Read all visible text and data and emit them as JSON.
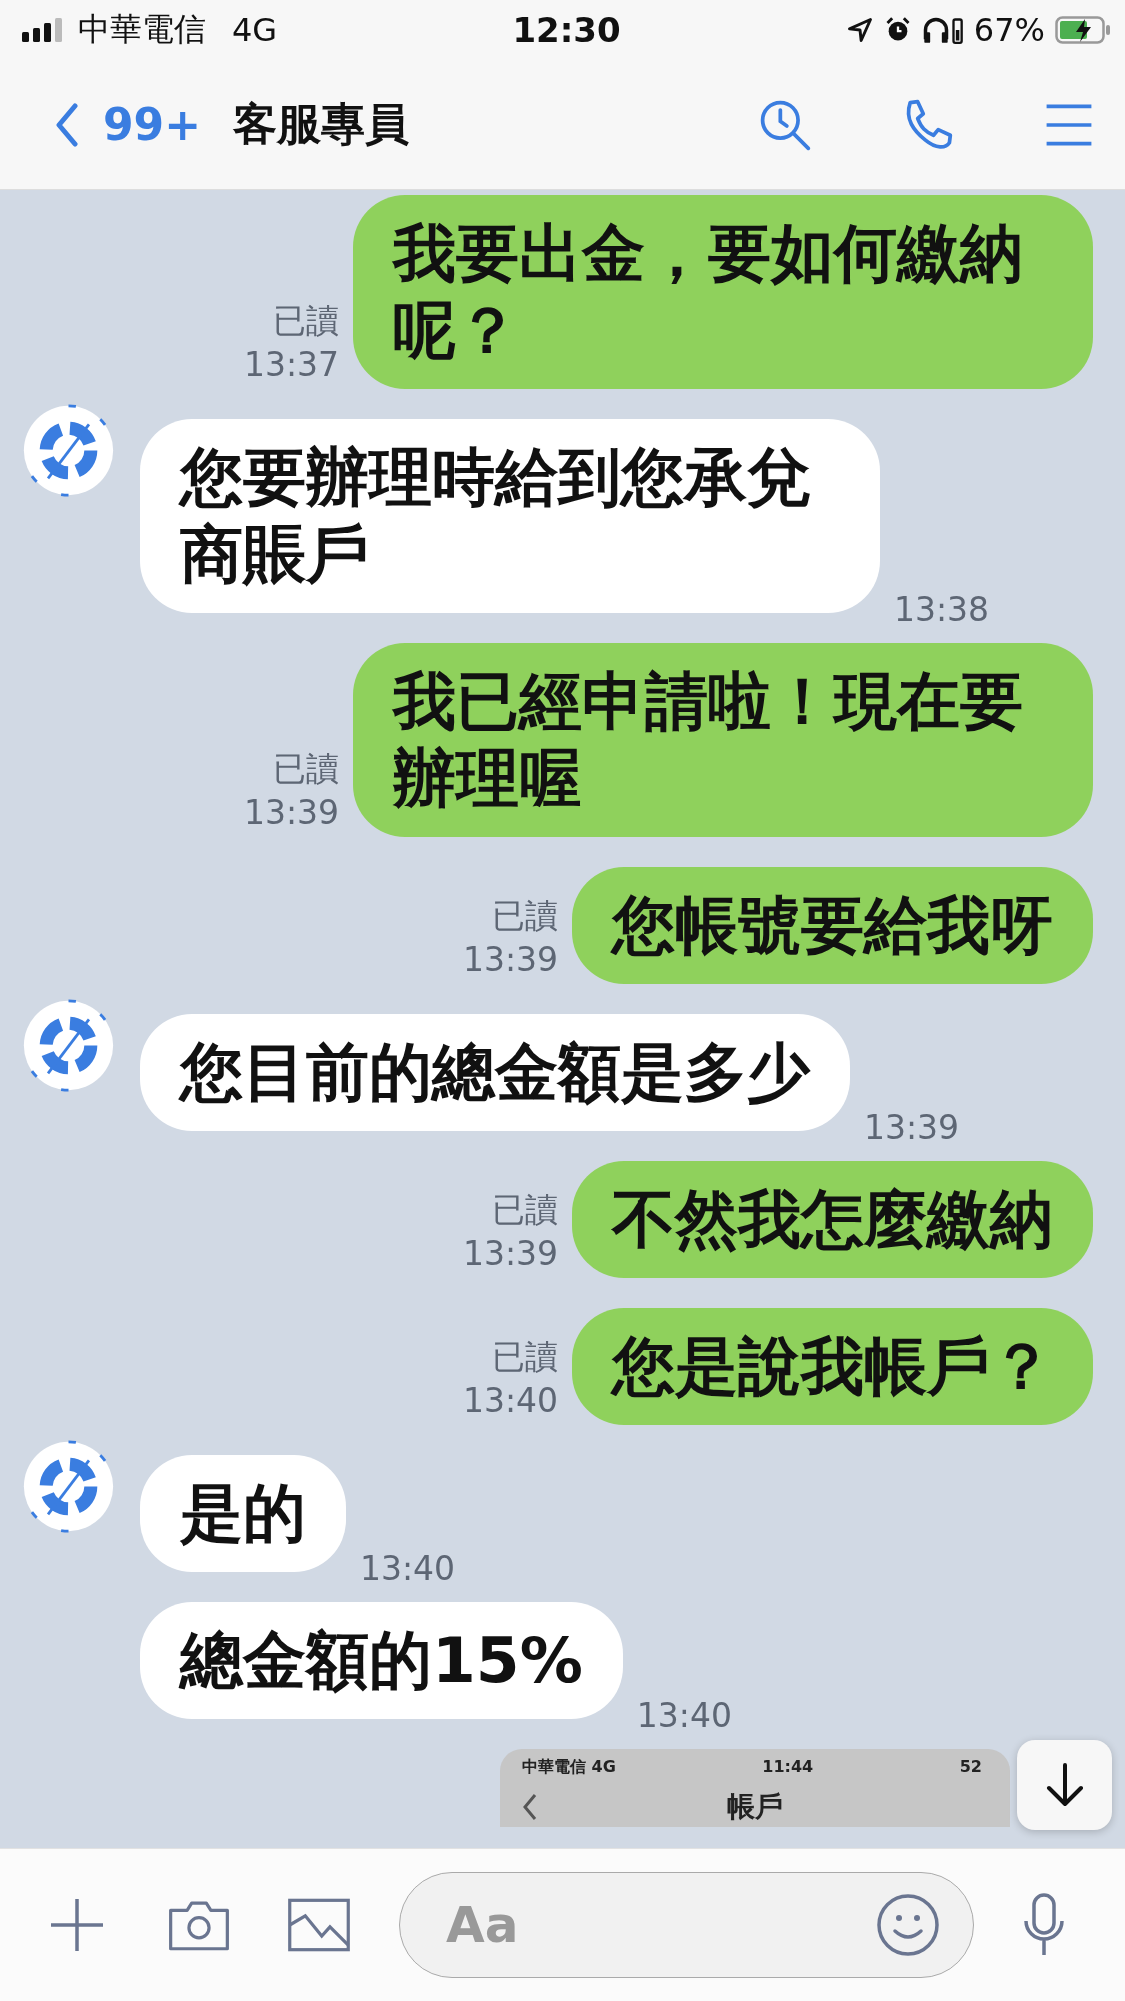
{
  "status_bar": {
    "carrier": "中華電信",
    "network": "4G",
    "time": "12:30",
    "battery": "67%"
  },
  "header": {
    "back_count": "99+",
    "title": "客服專員"
  },
  "messages": [
    {
      "kind": "sent",
      "text": "我要出金，要如何繳納呢？",
      "read": "已讀",
      "time": "13:37"
    },
    {
      "kind": "received",
      "avatar": true,
      "text": "您要辦理時給到您承兌商賬戶",
      "time": "13:38"
    },
    {
      "kind": "sent",
      "text": "我已經申請啦！現在要辦理喔",
      "read": "已讀",
      "time": "13:39"
    },
    {
      "kind": "sent",
      "text": "您帳號要給我呀",
      "read": "已讀",
      "time": "13:39"
    },
    {
      "kind": "received",
      "avatar": true,
      "text": "您目前的總金額是多少",
      "time": "13:39"
    },
    {
      "kind": "sent",
      "text": "不然我怎麼繳納",
      "read": "已讀",
      "time": "13:39"
    },
    {
      "kind": "sent",
      "text": "您是說我帳戶？",
      "read": "已讀",
      "time": "13:40"
    },
    {
      "kind": "received",
      "avatar": true,
      "text": "是的",
      "time": "13:40"
    },
    {
      "kind": "received",
      "avatar": false,
      "text": "總金額的15%",
      "time": "13:40"
    },
    {
      "kind": "image",
      "screenshot": {
        "carrier": "中華電信",
        "network": "4G",
        "time": "11:44",
        "battery": "52",
        "title": "帳戶"
      }
    }
  ],
  "input": {
    "placeholder": "Aa"
  }
}
